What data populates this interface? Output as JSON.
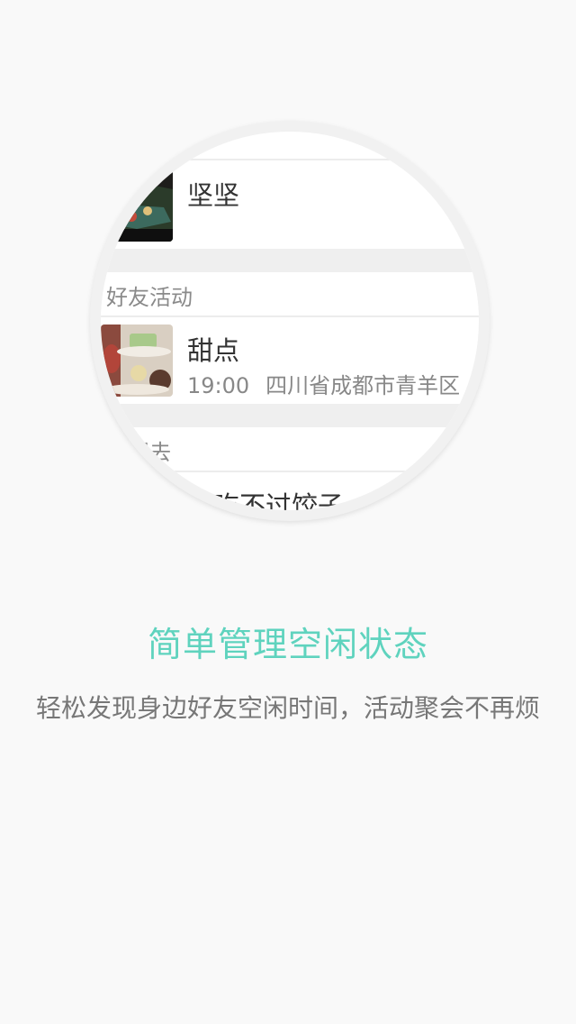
{
  "illustration": {
    "items": [
      {
        "name": "坚坚"
      },
      {
        "name": "甜点",
        "time": "19:00",
        "location": "四川省成都市青羊区"
      },
      {
        "name": "谁吃不过饺子"
      }
    ],
    "sections": [
      {
        "label": "好友活动"
      },
      {
        "label": "我想去"
      }
    ]
  },
  "onboarding": {
    "title": "简单管理空闲状态",
    "subtitle": "轻松发现身边好友空闲时间，活动聚会不再烦"
  },
  "colors": {
    "accent": "#5fd3be",
    "background": "#f9f9f9",
    "subtitle_text": "#777777"
  }
}
